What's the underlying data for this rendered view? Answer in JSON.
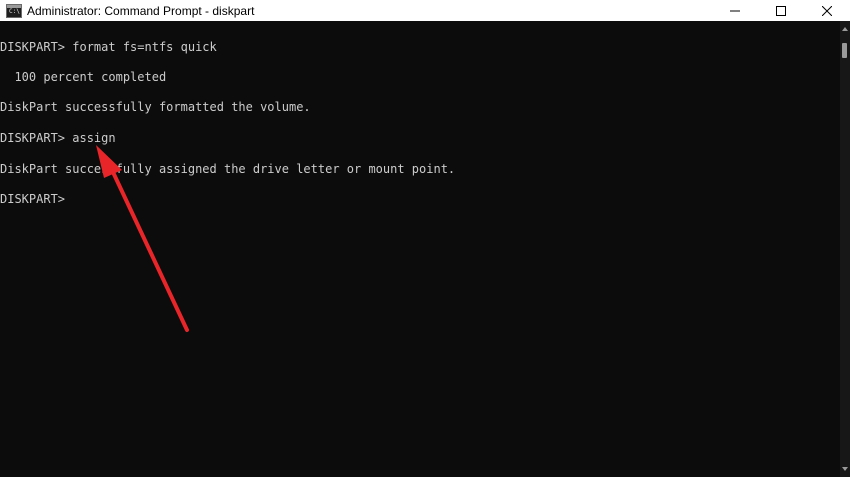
{
  "window": {
    "title": "Administrator: Command Prompt - diskpart",
    "icon": "command-prompt-icon",
    "controls": {
      "minimize": "minimize-icon",
      "maximize": "maximize-icon",
      "close": "close-icon"
    }
  },
  "console": {
    "lines": [
      "DISKPART> format fs=ntfs quick",
      "  100 percent completed",
      "DiskPart successfully formatted the volume.",
      "DISKPART> assign",
      "DiskPart successfully assigned the drive letter or mount point.",
      "DISKPART>"
    ]
  },
  "annotation": {
    "type": "arrow",
    "color": "#e8262a",
    "points_to": "assign"
  },
  "colors": {
    "background": "#0c0c0c",
    "text": "#cccccc",
    "titlebar": "#ffffff"
  }
}
